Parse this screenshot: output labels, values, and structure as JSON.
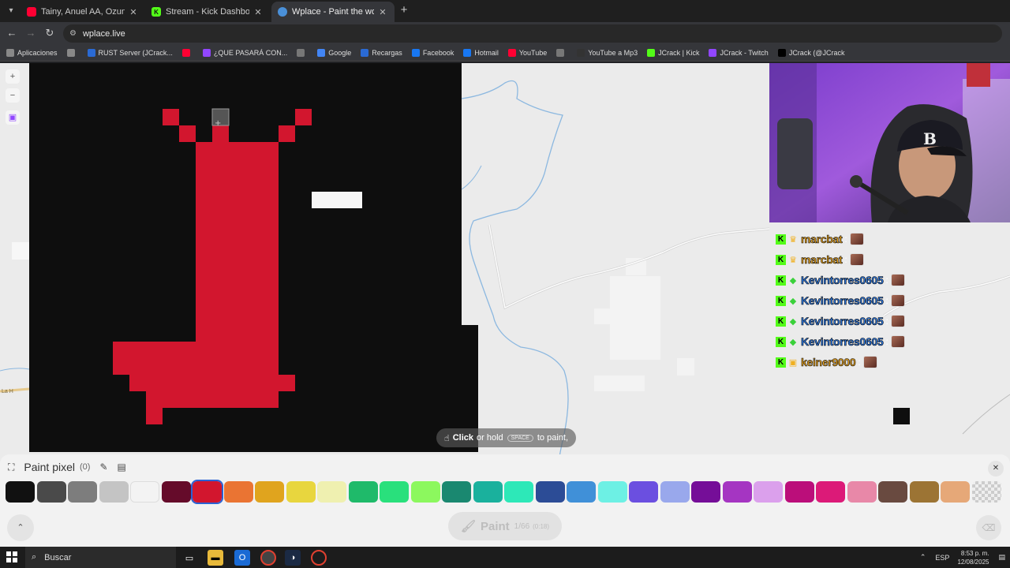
{
  "browser": {
    "tabs": [
      {
        "title": "Tainy, Anuel AA, Ozuna - Adicto",
        "favicon": "youtube-icon",
        "fav_color": "#ff0033",
        "active": false
      },
      {
        "title": "Stream - Kick Dashboard",
        "favicon": "kick-icon",
        "fav_color": "#53fc18",
        "active": false
      },
      {
        "title": "Wplace - Paint the world",
        "favicon": "wplace-globe-icon",
        "fav_color": "#4a90d9",
        "active": true
      }
    ],
    "url": "wplace.live",
    "bookmarks": [
      {
        "label": "Aplicaciones",
        "icon": "apps-grid-icon",
        "color": "#888"
      },
      {
        "label": "",
        "icon": "grid-icon",
        "color": "#888"
      },
      {
        "label": "RUST Server (JCrack...",
        "icon": "rust-icon",
        "color": "#2a6ad4"
      },
      {
        "label": "",
        "icon": "youtube-icon",
        "color": "#ff0033"
      },
      {
        "label": "¿QUE PASARÁ CON...",
        "icon": "twitch-icon",
        "color": "#9146ff"
      },
      {
        "label": "",
        "icon": "bookmark-dot-icon",
        "color": "#777"
      },
      {
        "label": "Google",
        "icon": "google-icon",
        "color": "#4285f4"
      },
      {
        "label": "Recargas",
        "icon": "recargas-icon",
        "color": "#2a6ad4"
      },
      {
        "label": "Facebook",
        "icon": "facebook-icon",
        "color": "#1877f2"
      },
      {
        "label": "Hotmail",
        "icon": "facebook-icon",
        "color": "#1877f2"
      },
      {
        "label": "YouTube",
        "icon": "youtube-icon",
        "color": "#ff0033"
      },
      {
        "label": "",
        "icon": "globe-icon",
        "color": "#777"
      },
      {
        "label": "YouTube a Mp3",
        "icon": "page-icon",
        "color": "#333"
      },
      {
        "label": "JCrack | Kick",
        "icon": "kick-icon",
        "color": "#53fc18"
      },
      {
        "label": "JCrack - Twitch",
        "icon": "twitch-icon",
        "color": "#9146ff"
      },
      {
        "label": "JCrack (@JCrack",
        "icon": "x-icon",
        "color": "#000"
      }
    ]
  },
  "map": {
    "road_label": "La H"
  },
  "stream": {
    "chat": [
      {
        "user": "marcbat",
        "badge": "crown-badge-icon",
        "color": "#e8a320"
      },
      {
        "user": "marcbat",
        "badge": "crown-badge-icon",
        "color": "#e8a320"
      },
      {
        "user": "Kevintorres0605",
        "badge": "diamond-badge-icon",
        "color": "#2d78e0"
      },
      {
        "user": "Kevintorres0605",
        "badge": "diamond-badge-icon",
        "color": "#2d78e0"
      },
      {
        "user": "Kevintorres0605",
        "badge": "diamond-badge-icon",
        "color": "#2d78e0"
      },
      {
        "user": "Kevintorres0605",
        "badge": "diamond-badge-icon",
        "color": "#2d78e0"
      },
      {
        "user": "keiner9000",
        "badge": "box-badge-icon",
        "color": "#e8a320"
      }
    ],
    "cap_letter": "B"
  },
  "hint": {
    "click": "Click",
    "or_hold": "or hold",
    "key": "SPACE",
    "to_paint": "to paint,"
  },
  "panel": {
    "title": "Paint pixel",
    "count": "(0)",
    "selected_color_index": 6,
    "colors": [
      "#111111",
      "#4a4a4a",
      "#7d7d7d",
      "#c4c4c4",
      "#f3f3f3",
      "#650b2a",
      "#d2162e",
      "#ea7433",
      "#e0a41e",
      "#e8d63e",
      "#eff0b0",
      "#1fba6a",
      "#29e07c",
      "#8cf85e",
      "#1a8870",
      "#1ab19d",
      "#2de8b8",
      "#2c4c96",
      "#4090d8",
      "#6df0e4",
      "#6b4fe0",
      "#99a8ec",
      "#750e98",
      "#a535c2",
      "#dba0ec",
      "#bb0e7a",
      "#dc1a78",
      "#e888a8",
      "#694a40",
      "#9c7434",
      "#e6a878",
      "transparent"
    ],
    "paint_label": "Paint",
    "paint_count": "1/66",
    "paint_timer": "(0:18)"
  },
  "taskbar": {
    "search_placeholder": "Buscar",
    "language": "ESP",
    "time": "8:53 p. m.",
    "date": "12/08/2025"
  }
}
